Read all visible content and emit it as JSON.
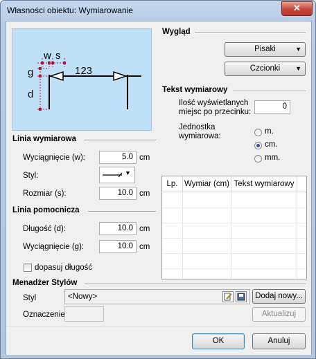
{
  "window": {
    "title": "Własności obiektu: Wymiarowanie",
    "close_label": "✕"
  },
  "preview": {
    "labels": {
      "w": "w",
      "s": "s",
      "g": "g",
      "d": "d",
      "value": "123"
    },
    "bg_color": "#bfe1f8"
  },
  "linia_wymiarowa": {
    "title": "Linia wymiarowa",
    "wyciagniecie_label": "Wyciągnięcie (w):",
    "wyciagniecie_value": "5.0",
    "wyciagniecie_unit": "cm",
    "styl_label": "Styl:",
    "rozmiar_label": "Rozmiar (s):",
    "rozmiar_value": "10.0",
    "rozmiar_unit": "cm"
  },
  "linia_pomocnicza": {
    "title": "Linia pomocnicza",
    "dlugosc_label": "Długość (d):",
    "dlugosc_value": "10.0",
    "dlugosc_unit": "cm",
    "wyciagniecie_label": "Wyciągnięcie (g):",
    "wyciagniecie_value": "10.0",
    "wyciagniecie_unit": "cm",
    "dopasuj_label": "dopasuj długość"
  },
  "wyglad": {
    "title": "Wygląd",
    "pisaki_label": "Pisaki",
    "czcionki_label": "Czcionki"
  },
  "tekst": {
    "title": "Tekst wymiarowy",
    "miejsc_label_1": "Ilość wyświetlanych",
    "miejsc_label_2": "miejsc po przecinku:",
    "miejsc_value": "0",
    "jednostka_label_1": "Jednostka",
    "jednostka_label_2": "wymiarowa:",
    "units": [
      "m.",
      "cm.",
      "mm."
    ],
    "selected_unit": "cm."
  },
  "table": {
    "columns": [
      "Lp.",
      "Wymiar (cm)",
      "Tekst wymiarowy"
    ]
  },
  "menadzer": {
    "title": "Menadżer Stylów",
    "styl_label": "Styl",
    "styl_value": "<Nowy>",
    "dodaj_label": "Dodaj nowy...",
    "oznaczenie_label": "Oznaczenie",
    "aktualizuj_label": "Aktualizuj"
  },
  "footer": {
    "ok_label": "OK",
    "cancel_label": "Anuluj"
  }
}
